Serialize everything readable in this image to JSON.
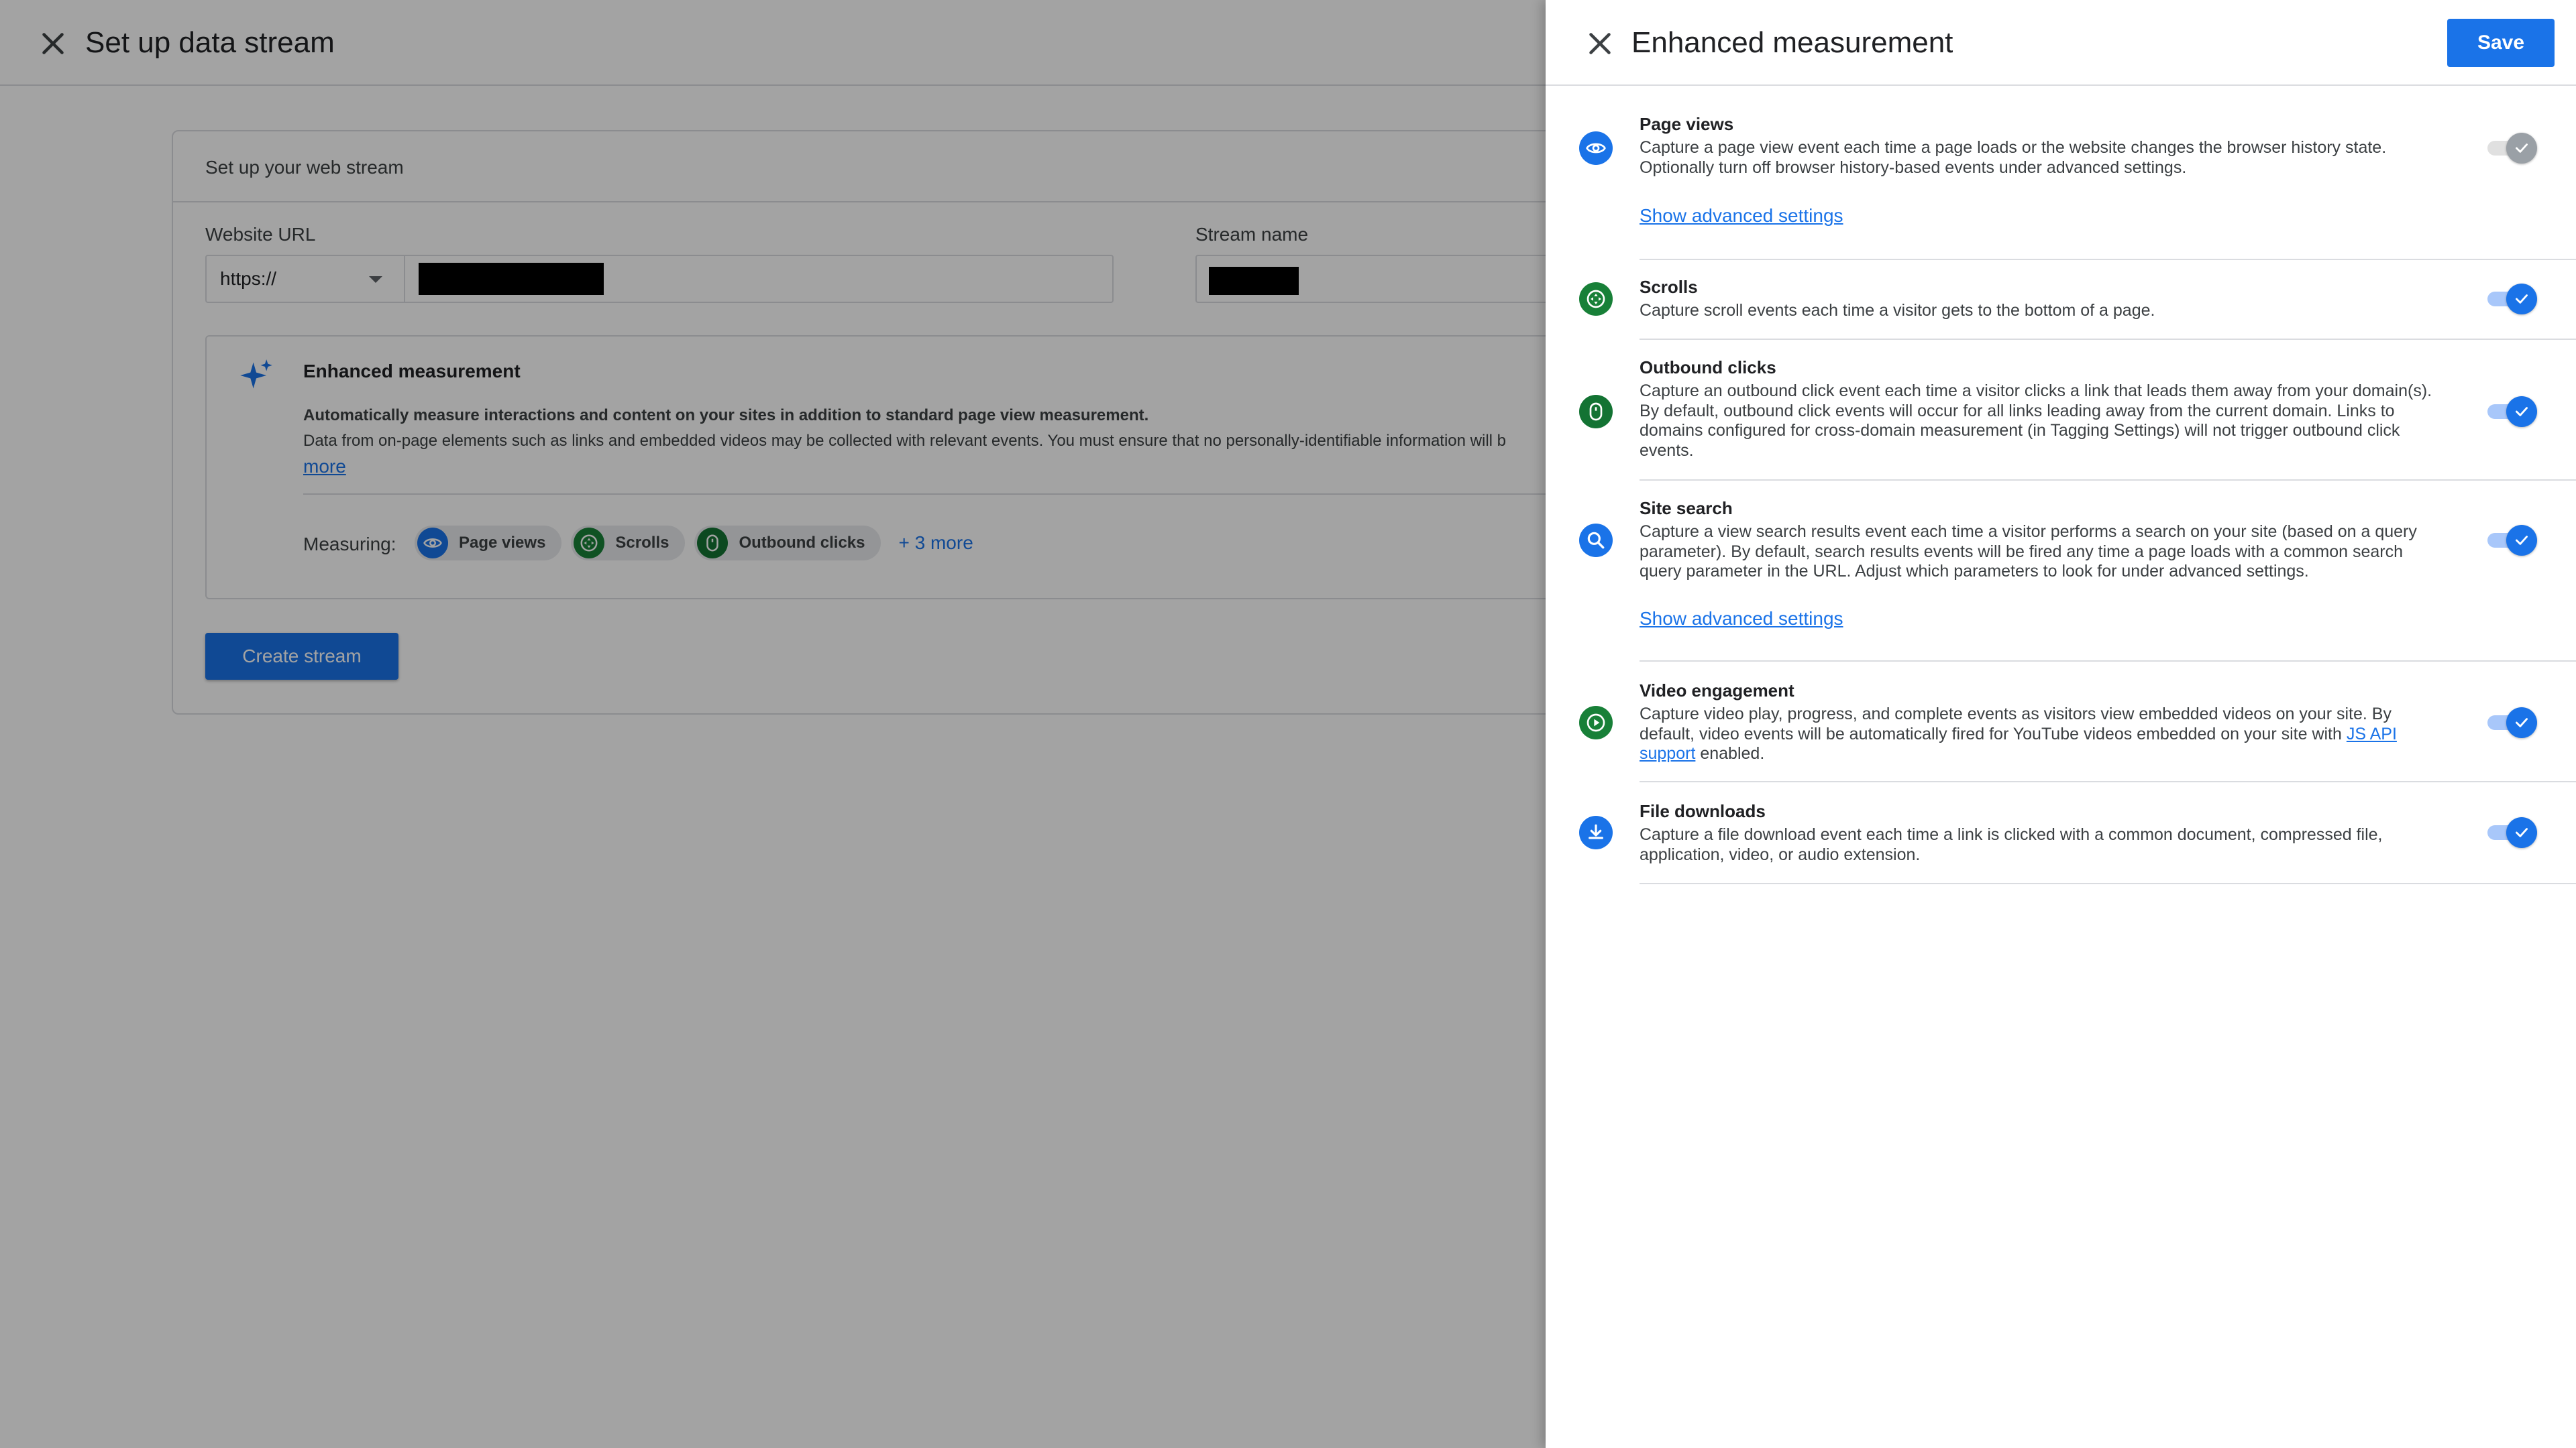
{
  "background": {
    "title": "Set up data stream",
    "card_title": "Set up your web stream",
    "website_url_label": "Website URL",
    "protocol": "https://",
    "stream_name_label": "Stream name",
    "enhanced": {
      "title": "Enhanced measurement",
      "desc_bold": "Automatically measure interactions and content on your sites in addition to standard page view measurement.",
      "desc": "Data from on-page elements such as links and embedded videos may be collected with relevant events. You must ensure that no personally-identifiable information will b",
      "more": "more",
      "measuring_label": "Measuring:",
      "chips": [
        "Page views",
        "Scrolls",
        "Outbound clicks"
      ],
      "more_chips": "+ 3 more"
    },
    "create_button": "Create stream"
  },
  "panel": {
    "title": "Enhanced measurement",
    "save_label": "Save",
    "settings": [
      {
        "title": "Page views",
        "desc": "Capture a page view event each time a page loads or the website changes the browser history state. Optionally turn off browser history-based events under advanced settings.",
        "advanced": "Show advanced settings",
        "enabled": true,
        "editable": false
      },
      {
        "title": "Scrolls",
        "desc": "Capture scroll events each time a visitor gets to the bottom of a page.",
        "enabled": true,
        "editable": true
      },
      {
        "title": "Outbound clicks",
        "desc": "Capture an outbound click event each time a visitor clicks a link that leads them away from your domain(s). By default, outbound click events will occur for all links leading away from the current domain. Links to domains configured for cross-domain measurement (in Tagging Settings) will not trigger outbound click events.",
        "enabled": true,
        "editable": true
      },
      {
        "title": "Site search",
        "desc": "Capture a view search results event each time a visitor performs a search on your site (based on a query parameter). By default, search results events will be fired any time a page loads with a common search query parameter in the URL. Adjust which parameters to look for under advanced settings.",
        "advanced": "Show advanced settings",
        "enabled": true,
        "editable": true
      },
      {
        "title": "Video engagement",
        "desc_before": "Capture video play, progress, and complete events as visitors view embedded videos on your site. By default, video events will be automatically fired for YouTube videos embedded on your site with ",
        "desc_link": "JS API support",
        "desc_after": " enabled.",
        "enabled": true,
        "editable": true
      },
      {
        "title": "File downloads",
        "desc": "Capture a file download event each time a link is clicked with a common document, compressed file, application, video, or audio extension.",
        "enabled": true,
        "editable": true
      }
    ]
  },
  "icons": {
    "page_views": "eye-icon",
    "scrolls": "scroll-arrows-icon",
    "outbound_clicks": "mouse-icon",
    "site_search": "search-icon",
    "video_engagement": "play-icon",
    "file_downloads": "download-icon"
  },
  "colors": {
    "primary": "#1a73e8",
    "green": "#188038",
    "teal": "#137333"
  }
}
